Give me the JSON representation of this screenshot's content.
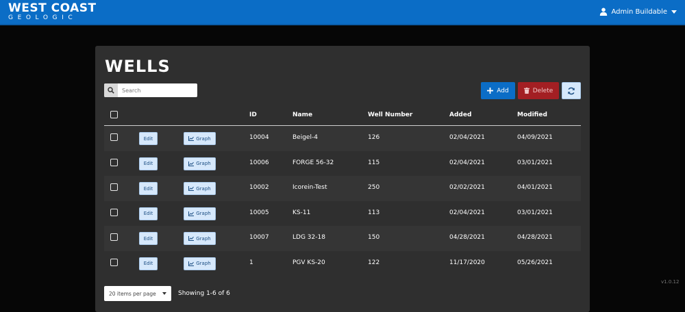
{
  "header": {
    "logo_line1": "WEST COAST",
    "logo_line2": "GEOLOGIC",
    "user_name": "Admin Buildable"
  },
  "page": {
    "title": "WELLS",
    "search_placeholder": "Search",
    "add_label": "Add",
    "delete_label": "Delete"
  },
  "table": {
    "columns": [
      "ID",
      "Name",
      "Well Number",
      "Added",
      "Modified"
    ],
    "edit_label": "Edit",
    "graph_label": "Graph",
    "rows": [
      {
        "id": "10004",
        "name": "Beigel-4",
        "well_number": "126",
        "added": "02/04/2021",
        "modified": "04/09/2021"
      },
      {
        "id": "10006",
        "name": "FORGE 56-32",
        "well_number": "115",
        "added": "02/04/2021",
        "modified": "03/01/2021"
      },
      {
        "id": "10002",
        "name": "Icorein-Test",
        "well_number": "250",
        "added": "02/02/2021",
        "modified": "04/01/2021"
      },
      {
        "id": "10005",
        "name": "KS-11",
        "well_number": "113",
        "added": "02/04/2021",
        "modified": "03/01/2021"
      },
      {
        "id": "10007",
        "name": "LDG 32-18",
        "well_number": "150",
        "added": "04/28/2021",
        "modified": "04/28/2021"
      },
      {
        "id": "1",
        "name": "PGV KS-20",
        "well_number": "122",
        "added": "11/17/2020",
        "modified": "05/26/2021"
      }
    ]
  },
  "footer": {
    "per_page": "20 items per page",
    "showing": "Showing 1-6 of 6",
    "version": "v1.0.12"
  },
  "colors": {
    "brand": "#0b6dc6",
    "danger": "#a31f23",
    "panel": "#2f2f2f",
    "background": "#060606"
  }
}
